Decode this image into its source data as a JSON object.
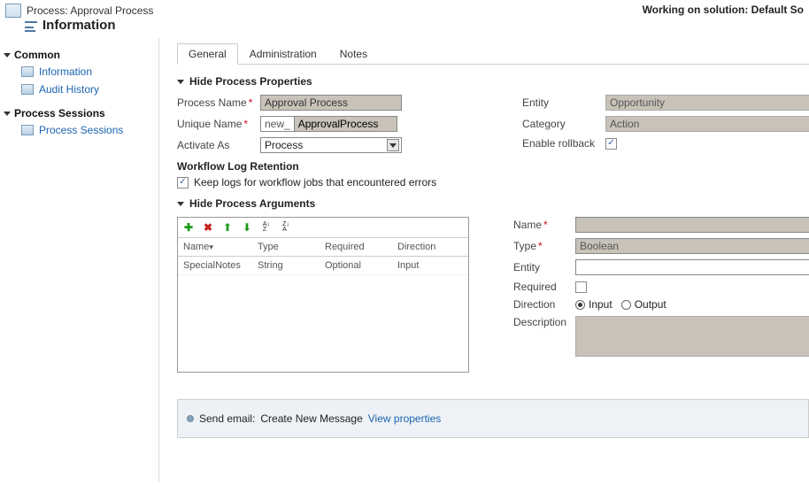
{
  "header": {
    "process_label": "Process: Approval Process",
    "info_label": "Information",
    "solution": "Working on solution: Default So"
  },
  "sidebar": {
    "groups": [
      {
        "title": "Common",
        "items": [
          {
            "icon": "info-icon",
            "label": "Information"
          },
          {
            "icon": "history-icon",
            "label": "Audit History"
          }
        ]
      },
      {
        "title": "Process Sessions",
        "items": [
          {
            "icon": "sessions-icon",
            "label": "Process Sessions"
          }
        ]
      }
    ]
  },
  "tabs": [
    "General",
    "Administration",
    "Notes"
  ],
  "properties": {
    "section_title": "Hide Process Properties",
    "process_name_label": "Process Name",
    "process_name_value": "Approval Process",
    "unique_name_label": "Unique Name",
    "unique_name_prefix": "new_",
    "unique_name_value": "ApprovalProcess",
    "activate_as_label": "Activate As",
    "activate_as_value": "Process",
    "entity_label": "Entity",
    "entity_value": "Opportunity",
    "category_label": "Category",
    "category_value": "Action",
    "enable_rollback_label": "Enable rollback",
    "enable_rollback_checked": true,
    "log_retention_title": "Workflow Log Retention",
    "log_retention_label": "Keep logs for workflow jobs that encountered errors",
    "log_retention_checked": true
  },
  "arguments": {
    "section_title": "Hide Process Arguments",
    "toolbar": [
      "add",
      "delete",
      "up",
      "down",
      "sort-asc",
      "sort-desc"
    ],
    "columns": [
      "Name",
      "Type",
      "Required",
      "Direction"
    ],
    "rows": [
      {
        "name": "SpecialNotes",
        "type": "String",
        "required": "Optional",
        "direction": "Input"
      }
    ],
    "detail": {
      "name_label": "Name",
      "name_value": "",
      "type_label": "Type",
      "type_value": "Boolean",
      "entity_label": "Entity",
      "entity_value": "",
      "required_label": "Required",
      "required_checked": false,
      "direction_label": "Direction",
      "direction_input_label": "Input",
      "direction_output_label": "Output",
      "direction_value": "Input",
      "description_label": "Description"
    }
  },
  "step": {
    "label_prefix": "Send email:",
    "label": "Create New Message",
    "link": "View properties"
  }
}
